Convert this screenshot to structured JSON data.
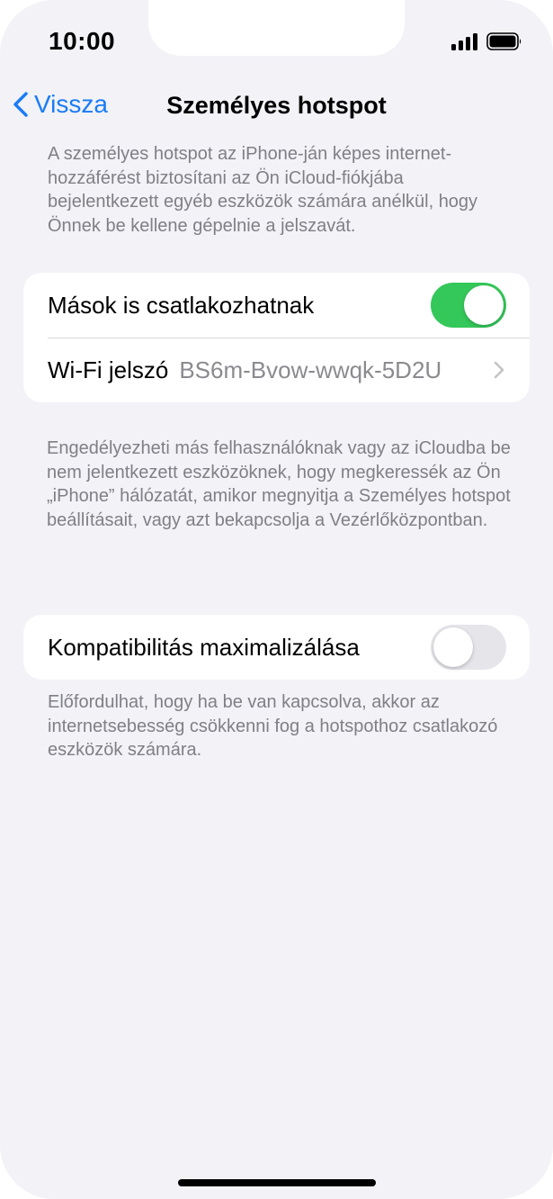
{
  "status_bar": {
    "time": "10:00"
  },
  "nav": {
    "back_label": "Vissza",
    "title": "Személyes hotspot"
  },
  "intro_text": "A személyes hotspot az iPhone-ján képes internet-hozzáférést biztosítani az Ön iCloud-fiókjába bejelentkezett egyéb eszközök számára anélkül, hogy Önnek be kellene gépelnie a jelszavát.",
  "group1": {
    "allow_others": {
      "label": "Mások is csatlakozhatnak",
      "enabled": true
    },
    "wifi_password": {
      "label": "Wi-Fi jelszó",
      "value": "BS6m-Bvow-wwqk-5D2U"
    }
  },
  "group1_footer": "Engedélyezheti más felhasználóknak vagy az iCloudba be nem jelentkezett eszközöknek, hogy megkeressék az Ön „iPhone” hálózatát, amikor megnyitja a Személyes hotspot beállításait, vagy azt bekapcsolja a Vezérlőközpontban.",
  "group2": {
    "maximize_compat": {
      "label": "Kompatibilitás maximalizálása",
      "enabled": false
    }
  },
  "group2_footer": "Előfordulhat, hogy ha be van kapcsolva, akkor az internetsebesség csökkenni fog a hotspothoz csatlakozó eszközök számára.",
  "colors": {
    "accent": "#1a7cf5",
    "toggle_on": "#34c759",
    "toggle_off": "#e5e5ea",
    "background": "#f2f2f7",
    "secondary_text": "#7f7f85"
  },
  "icons": {
    "back": "chevron-left-icon",
    "disclosure": "chevron-right-icon",
    "signal": "cellular-signal-icon",
    "battery": "battery-icon"
  }
}
